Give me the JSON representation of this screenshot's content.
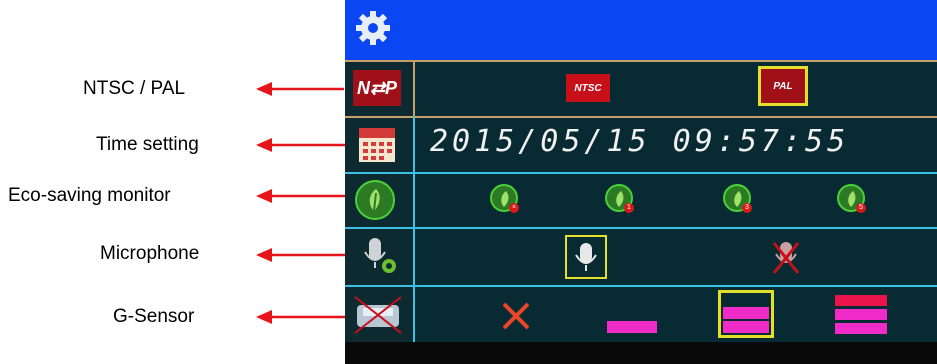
{
  "annotations": [
    {
      "key": "ntsc",
      "text": "NTSC  /  PAL"
    },
    {
      "key": "time",
      "text": "Time setting"
    },
    {
      "key": "eco",
      "text": "Eco-saving monitor"
    },
    {
      "key": "mic",
      "text": "Microphone"
    },
    {
      "key": "gsensor",
      "text": "G-Sensor"
    }
  ],
  "settings": {
    "gear_icon": "gear-icon",
    "video": {
      "icon_text": "N⇄P",
      "options": [
        "NTSC",
        "PAL"
      ],
      "selected": "PAL"
    },
    "datetime": {
      "value": "2015/05/15  09:57:55"
    },
    "eco": {
      "options": [
        "off",
        "1",
        "3",
        "5"
      ],
      "badges": [
        "×",
        "1",
        "3",
        "5"
      ]
    },
    "microphone": {
      "options": [
        "on",
        "off"
      ],
      "selected": "on"
    },
    "gsensor": {
      "options": [
        "off",
        "low",
        "medium",
        "high"
      ],
      "selected": "medium"
    }
  },
  "colors": {
    "top_bar": "#0a47f2",
    "screen_bg": "#072a33",
    "divider_tan": "#c8a06a",
    "divider_cyan": "#3cc1e6",
    "selection_yellow": "#e3df2a",
    "accent_red": "#c8101a",
    "magenta": "#f02cc8",
    "arrow_red": "#e8141c"
  }
}
